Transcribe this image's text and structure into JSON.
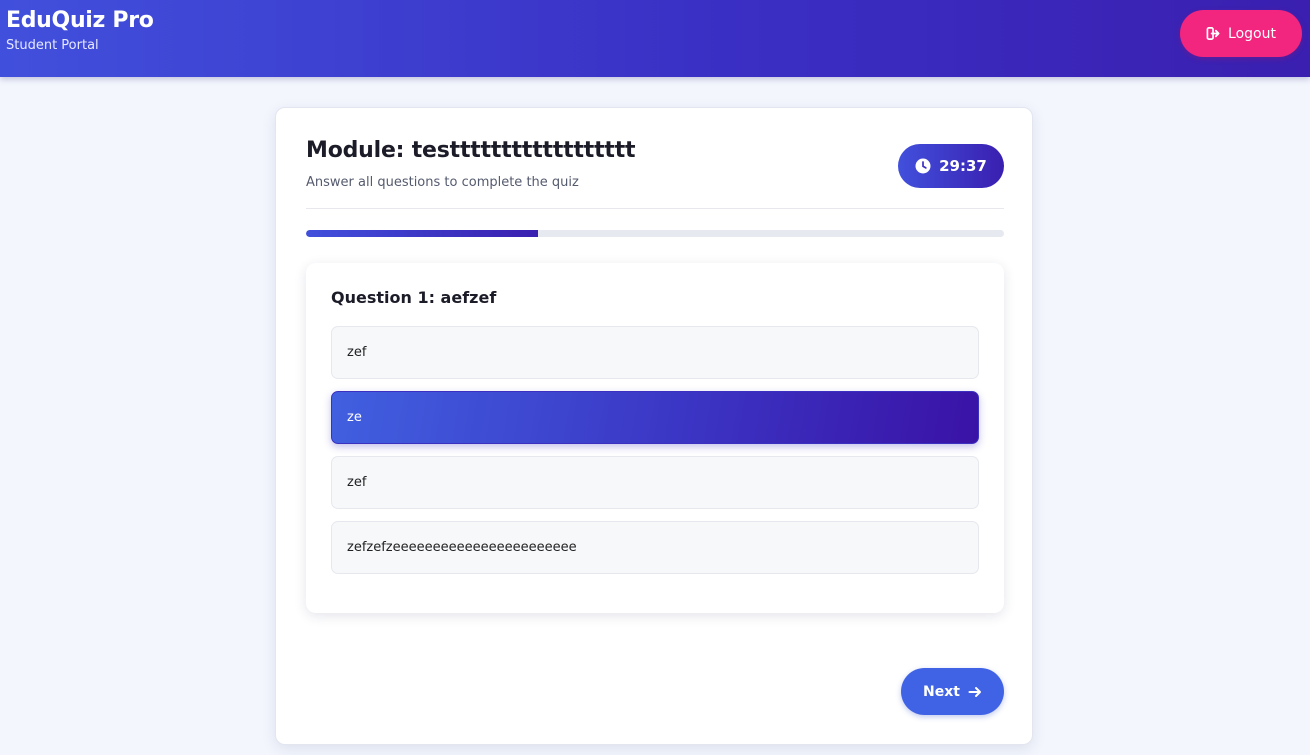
{
  "header": {
    "brand_title": "EduQuiz Pro",
    "brand_subtitle": "Student Portal",
    "logout_label": "Logout",
    "logout_icon": "logout-icon"
  },
  "quiz": {
    "module_title": "Module: testttttttttttttttttt",
    "subtitle": "Answer all questions to complete the quiz",
    "timer": "29:37",
    "timer_icon": "clock-icon",
    "progress_fraction": 0.333,
    "question": {
      "title": "Question 1: aefzef",
      "options": [
        {
          "label": "zef",
          "selected": false
        },
        {
          "label": "ze",
          "selected": true
        },
        {
          "label": "zef",
          "selected": false
        },
        {
          "label": "zefzefzeeeeeeeeeeeeeeeeeeeeeee",
          "selected": false
        }
      ]
    },
    "next_label": "Next",
    "next_icon": "arrow-right-icon"
  },
  "colors": {
    "header_gradient_start": "#4150dc",
    "header_gradient_end": "#3a1fb0",
    "logout_bg": "#f2257f",
    "accent": "#4063e6",
    "page_bg": "#f3f6fd"
  }
}
